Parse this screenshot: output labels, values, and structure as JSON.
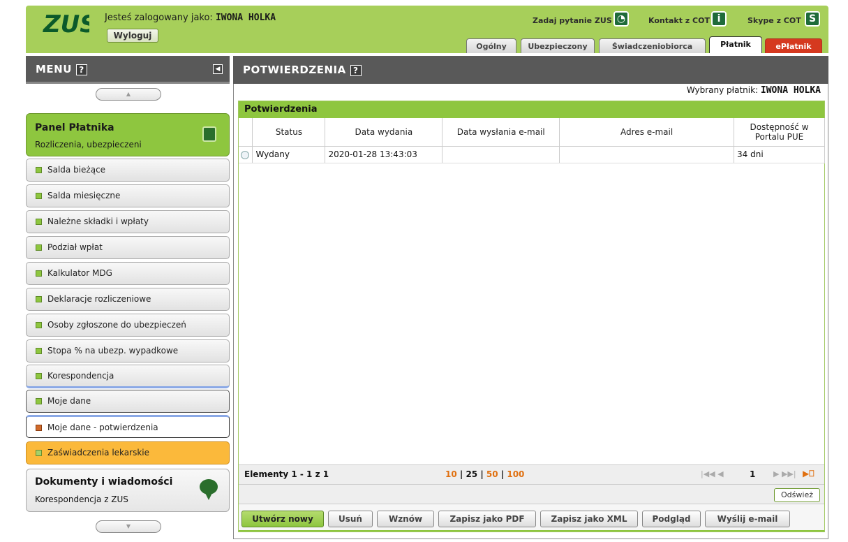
{
  "header": {
    "logo_text": "ZUS",
    "logged_prefix": "Jesteś zalogowany jako:",
    "logged_user": "IWONA HOLKA",
    "logout_label": "Wyloguj",
    "links": [
      {
        "label": "Zadaj pytanie ZUS",
        "icon": "question-bubble-icon"
      },
      {
        "label": "Kontakt z COT",
        "icon": "info-icon"
      },
      {
        "label": "Skype z COT",
        "icon": "skype-icon"
      }
    ],
    "tabs": [
      {
        "label": "Ogólny"
      },
      {
        "label": "Ubezpieczony"
      },
      {
        "label": "Świadczeniobiorca"
      },
      {
        "label": "Płatnik"
      },
      {
        "label": "ePłatnik"
      }
    ]
  },
  "menu": {
    "title": "MENU",
    "help": "?",
    "scroll_up": "▲",
    "scroll_down": "▼",
    "panel": {
      "title": "Panel Płatnika",
      "subtitle": "Rozliczenia, ubezpieczeni"
    },
    "items": [
      {
        "label": "Salda bieżące"
      },
      {
        "label": "Salda miesięczne"
      },
      {
        "label": "Należne składki i wpłaty"
      },
      {
        "label": "Podział wpłat"
      },
      {
        "label": "Kalkulator MDG"
      },
      {
        "label": "Deklaracje rozliczeniowe"
      },
      {
        "label": "Osoby zgłoszone do ubezpieczeń"
      },
      {
        "label": "Stopa % na ubezp. wypadkowe"
      },
      {
        "label": "Korespondencja"
      },
      {
        "label": "Moje dane"
      },
      {
        "label": "Moje dane - potwierdzenia"
      },
      {
        "label": "Zaświadczenia lekarskie"
      }
    ],
    "docs": {
      "title": "Dokumenty i wiadomości",
      "subtitle": "Korespondencja z ZUS"
    }
  },
  "main": {
    "title": "POTWIERDZENIA",
    "help": "?",
    "payer_label": "Wybrany płatnik:",
    "payer_name": "IWONA HOLKA",
    "grid_title": "Potwierdzenia",
    "columns": [
      "Status",
      "Data wydania",
      "Data wysłania e-mail",
      "Adres e-mail",
      "Dostępność w Portalu PUE"
    ],
    "rows": [
      {
        "status": "Wydany",
        "issued": "2020-01-28 13:43:03",
        "sent": "",
        "email": "",
        "availability": "34 dni"
      }
    ],
    "pager": {
      "elements": "Elementy 1 - 1 z 1",
      "sizes": [
        "10",
        "25",
        "50",
        "100"
      ],
      "first_prev": "|◀◀ ◀",
      "page": "1",
      "next_last": "▶ ▶▶|",
      "last": "▶⎕"
    },
    "refresh_label": "Odśwież",
    "actions": [
      "Utwórz nowy",
      "Usuń",
      "Wznów",
      "Zapisz jako PDF",
      "Zapisz jako XML",
      "Podgląd",
      "Wyślij e-mail"
    ]
  }
}
